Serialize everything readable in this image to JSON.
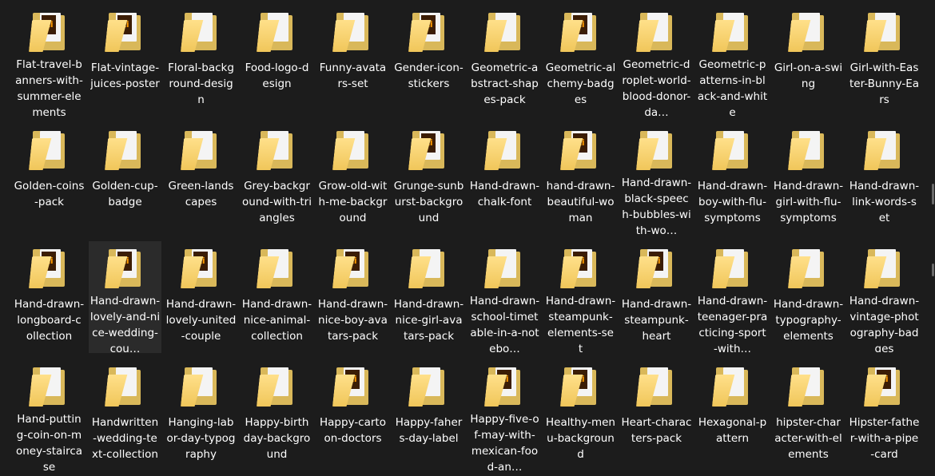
{
  "folders": [
    {
      "label": "Flat-travel-banners-with-summer-elements",
      "icon": "folder-ai-icon",
      "preview": "ai"
    },
    {
      "label": "Flat-vintage-juices-poster",
      "icon": "folder-ai-icon",
      "preview": "ai"
    },
    {
      "label": "Floral-background-design",
      "icon": "folder-icon",
      "preview": "plain"
    },
    {
      "label": "Food-logo-design",
      "icon": "folder-icon",
      "preview": "plain"
    },
    {
      "label": "Funny-avatars-set",
      "icon": "folder-icon",
      "preview": "plain"
    },
    {
      "label": "Gender-icon-stickers",
      "icon": "folder-ai-icon",
      "preview": "ai"
    },
    {
      "label": "Geometric-abstract-shapes-pack",
      "icon": "folder-icon",
      "preview": "plain"
    },
    {
      "label": "Geometric-alchemy-badges",
      "icon": "folder-ai-icon",
      "preview": "ai"
    },
    {
      "label": "Geometric-droplet-world-blood-donor-da…",
      "icon": "folder-icon",
      "preview": "plain"
    },
    {
      "label": "Geometric-patterns-in-black-and-white",
      "icon": "folder-icon",
      "preview": "plain"
    },
    {
      "label": "Girl-on-a-swing",
      "icon": "folder-icon",
      "preview": "plain"
    },
    {
      "label": "Girl-with-Easter-Bunny-Ears",
      "icon": "folder-icon",
      "preview": "plain"
    },
    {
      "label": "Golden-coins-pack",
      "icon": "folder-icon",
      "preview": "plain"
    },
    {
      "label": "Golden-cup-badge",
      "icon": "folder-icon",
      "preview": "plain"
    },
    {
      "label": "Green-landscapes",
      "icon": "folder-icon",
      "preview": "plain"
    },
    {
      "label": "Grey-background-with-triangles",
      "icon": "folder-icon",
      "preview": "plain"
    },
    {
      "label": "Grow-old-with-me-background",
      "icon": "folder-icon",
      "preview": "plain"
    },
    {
      "label": "Grunge-sunburst-background",
      "icon": "folder-ai-icon",
      "preview": "ai"
    },
    {
      "label": "Hand-drawn-chalk-font",
      "icon": "folder-icon",
      "preview": "plain"
    },
    {
      "label": "hand-drawn-beautiful-woman",
      "icon": "folder-ai-icon",
      "preview": "ai"
    },
    {
      "label": "Hand-drawn-black-speech-bubbles-with-wo…",
      "icon": "folder-icon",
      "preview": "plain"
    },
    {
      "label": "Hand-drawn-boy-with-flu-symptoms",
      "icon": "folder-icon",
      "preview": "plain"
    },
    {
      "label": "Hand-drawn-girl-with-flu-symptoms",
      "icon": "folder-icon",
      "preview": "plain"
    },
    {
      "label": "Hand-drawn-link-words-set",
      "icon": "folder-icon",
      "preview": "plain"
    },
    {
      "label": "Hand-drawn-longboard-collection",
      "icon": "folder-ai-icon",
      "preview": "ai"
    },
    {
      "label": "Hand-drawn-lovely-and-nice-wedding-cou…",
      "icon": "folder-ai-icon",
      "preview": "ai",
      "selected": true
    },
    {
      "label": "Hand-drawn-lovely-united-couple",
      "icon": "folder-ai-icon",
      "preview": "ai"
    },
    {
      "label": "Hand-drawn-nice-animal-collection",
      "icon": "folder-icon",
      "preview": "plain"
    },
    {
      "label": "Hand-drawn-nice-boy-avatars-pack",
      "icon": "folder-ai-icon",
      "preview": "ai"
    },
    {
      "label": "Hand-drawn-nice-girl-avatars-pack",
      "icon": "folder-icon",
      "preview": "plain"
    },
    {
      "label": "Hand-drawn-school-timetable-in-a-notebo…",
      "icon": "folder-icon",
      "preview": "plain"
    },
    {
      "label": "Hand-drawn-steampunk-elements-set",
      "icon": "folder-ai-icon",
      "preview": "ai"
    },
    {
      "label": "Hand-drawn-steampunk-heart",
      "icon": "folder-ai-icon",
      "preview": "ai"
    },
    {
      "label": "Hand-drawn-teenager-practicing-sport-with…",
      "icon": "folder-icon",
      "preview": "plain"
    },
    {
      "label": "Hand-drawn-typography-elements",
      "icon": "folder-icon",
      "preview": "plain"
    },
    {
      "label": "Hand-drawn-vintage-photography-badges",
      "icon": "folder-icon",
      "preview": "plain"
    },
    {
      "label": "Hand-putting-coin-on-money-staircase",
      "icon": "folder-icon",
      "preview": "plain"
    },
    {
      "label": "Handwritten-wedding-text-collection",
      "icon": "folder-icon",
      "preview": "plain"
    },
    {
      "label": "Hanging-labor-day-typography",
      "icon": "folder-icon",
      "preview": "plain"
    },
    {
      "label": "Happy-birthday-background",
      "icon": "folder-icon",
      "preview": "plain"
    },
    {
      "label": "Happy-cartoon-doctors",
      "icon": "folder-ai-icon",
      "preview": "ai"
    },
    {
      "label": "Happy-fahers-day-label",
      "icon": "folder-icon",
      "preview": "plain"
    },
    {
      "label": "Happy-five-of-may-with-mexican-food-an…",
      "icon": "folder-ai-icon",
      "preview": "ai"
    },
    {
      "label": "Healthy-menu-background",
      "icon": "folder-ai-icon",
      "preview": "ai"
    },
    {
      "label": "Heart-characters-pack",
      "icon": "folder-icon",
      "preview": "plain"
    },
    {
      "label": "Hexagonal-pattern",
      "icon": "folder-icon",
      "preview": "plain"
    },
    {
      "label": "hipster-character-with-elements",
      "icon": "folder-icon",
      "preview": "plain"
    },
    {
      "label": "Hipster-father-with-a-pipe-card",
      "icon": "folder-ai-icon",
      "preview": "ai"
    }
  ]
}
